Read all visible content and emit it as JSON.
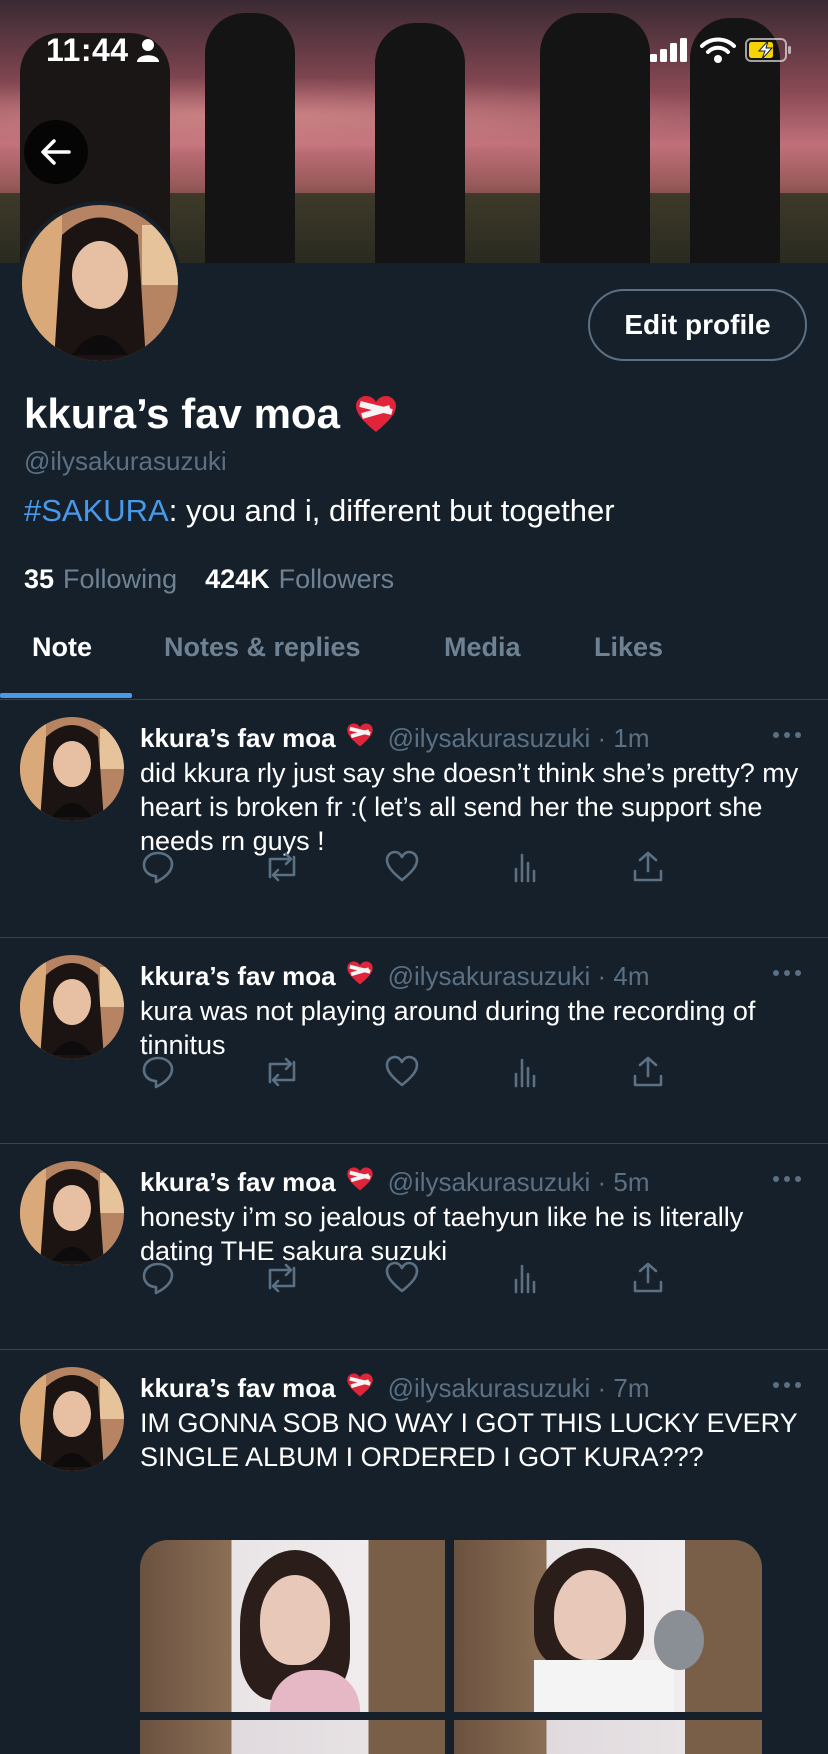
{
  "status_bar": {
    "time": "11:44"
  },
  "profile": {
    "display_name": "kkura’s fav moa",
    "username": "@ilysakurasuzuki",
    "bio_hashtag": "#SAKURA",
    "bio_text": ": you and i, different but together",
    "following_count": "35",
    "following_label": "Following",
    "followers_count": "424K",
    "followers_label": "Followers",
    "edit_profile_label": "Edit profile"
  },
  "tabs": [
    {
      "label": "Note",
      "active": true
    },
    {
      "label": "Notes & replies",
      "active": false
    },
    {
      "label": "Media",
      "active": false
    },
    {
      "label": "Likes",
      "active": false
    }
  ],
  "tweets": [
    {
      "name": "kkura’s fav moa",
      "handle": "@ilysakurasuzuki · 1m",
      "text": "did kkura rly just say she doesn’t think she’s pretty? my heart is broken fr :( let’s all send her the support she needs rn guys !"
    },
    {
      "name": "kkura’s fav moa",
      "handle": "@ilysakurasuzuki · 4m",
      "text": "kura was not playing around during the recording of tinnitus"
    },
    {
      "name": "kkura’s fav moa",
      "handle": "@ilysakurasuzuki · 5m",
      "text": "honesty i’m so jealous of taehyun like he is literally dating THE sakura suzuki"
    },
    {
      "name": "kkura’s fav moa",
      "handle": "@ilysakurasuzuki · 7m",
      "text": "IM GONNA SOB NO WAY I GOT THIS LUCKY EVERY SINGLE ALBUM I ORDERED I GOT KURA???"
    }
  ],
  "icons": {
    "back": "arrow-left-icon",
    "heart_emoji": "mending-heart-icon",
    "more": "more-horizontal-icon",
    "reply": "reply-icon",
    "retweet": "retweet-icon",
    "like": "heart-icon",
    "views": "views-icon",
    "share": "share-icon"
  },
  "colors": {
    "background": "#15202b",
    "accent": "#4a99e9",
    "muted": "#5b7083",
    "divider": "#38444d"
  }
}
